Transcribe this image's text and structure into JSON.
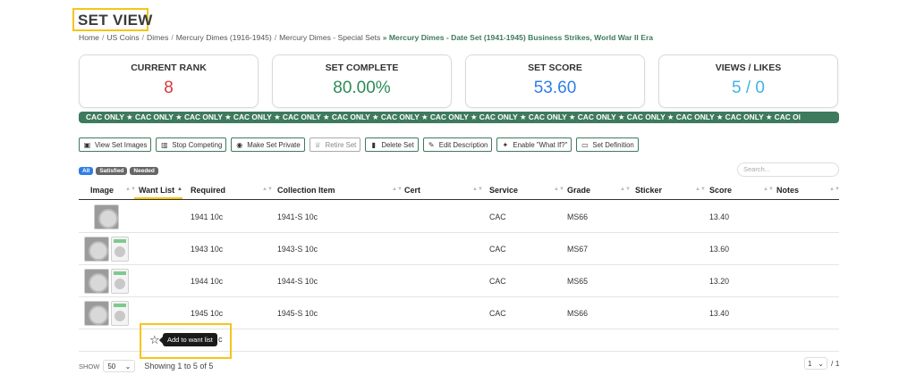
{
  "page": {
    "title": "SET VIEW"
  },
  "breadcrumb": {
    "items": [
      "Home",
      "US Coins",
      "Dimes",
      "Mercury Dimes (1916-1945)",
      "Mercury Dimes - Special Sets"
    ],
    "separator": "/",
    "current_prefix": "»",
    "current": "Mercury Dimes - Date Set (1941-1945) Business Strikes, World War II Era"
  },
  "stats": [
    {
      "label": "CURRENT RANK",
      "value": "8",
      "color": "#d9383a"
    },
    {
      "label": "SET COMPLETE",
      "value": "80.00%",
      "color": "#2e8b57"
    },
    {
      "label": "SET SCORE",
      "value": "53.60",
      "color": "#2f7ee8"
    },
    {
      "label": "VIEWS / LIKES",
      "value": "5 / 0",
      "color": "#3fb4e0"
    }
  ],
  "cac_banner": {
    "text": "CAC ONLY  ★  CAC ONLY  ★  CAC ONLY  ★  CAC ONLY  ★  CAC ONLY  ★  CAC ONLY  ★  CAC ONLY  ★  CAC ONLY  ★  CAC ONLY  ★  CAC ONLY  ★  CAC ONLY  ★  CAC ONLY  ★  CAC ONLY  ★  CAC ONLY  ★  CAC Ol",
    "color": "#3e7a5d"
  },
  "toolbar": {
    "view_images": "View Set Images",
    "stop_competing": "Stop Competing",
    "make_private": "Make Set Private",
    "retire": "Retire Set",
    "delete": "Delete Set",
    "edit_description": "Edit Description",
    "what_if": "Enable \"What If?\"",
    "definition": "Set Definition"
  },
  "filters": {
    "all": "All",
    "satisfied": "Satisfied",
    "needed": "Needed"
  },
  "search": {
    "placeholder": "Search..."
  },
  "table": {
    "headers": {
      "image": "Image",
      "want_list": "Want List",
      "required": "Required",
      "collection_item": "Collection Item",
      "cert": "Cert",
      "service": "Service",
      "grade": "Grade",
      "sticker": "Sticker",
      "score": "Score",
      "notes": "Notes"
    },
    "rows": [
      {
        "required": "1941 10c",
        "item": "1941-S 10c",
        "cert": "",
        "service": "CAC",
        "grade": "MS66",
        "sticker": "",
        "score": "13.40",
        "notes": ""
      },
      {
        "required": "1943 10c",
        "item": "1943-S 10c",
        "cert": "",
        "service": "CAC",
        "grade": "MS67",
        "sticker": "",
        "score": "13.60",
        "notes": ""
      },
      {
        "required": "1944 10c",
        "item": "1944-S 10c",
        "cert": "",
        "service": "CAC",
        "grade": "MS65",
        "sticker": "",
        "score": "13.20",
        "notes": ""
      },
      {
        "required": "1945 10c",
        "item": "1945-S 10c",
        "cert": "",
        "service": "CAC",
        "grade": "MS66",
        "sticker": "",
        "score": "13.40",
        "notes": ""
      }
    ],
    "last_row_partial": "c"
  },
  "tooltip": {
    "text": "Add to want list"
  },
  "footer": {
    "show_label": "SHOW",
    "page_size": "50",
    "showing": "Showing 1 to 5 of 5",
    "page": "1",
    "of_pages": "/ 1"
  },
  "colors": {
    "accent_green": "#3e7a5d",
    "highlight": "#f5c518",
    "filter_active": "#2f7ee8"
  }
}
